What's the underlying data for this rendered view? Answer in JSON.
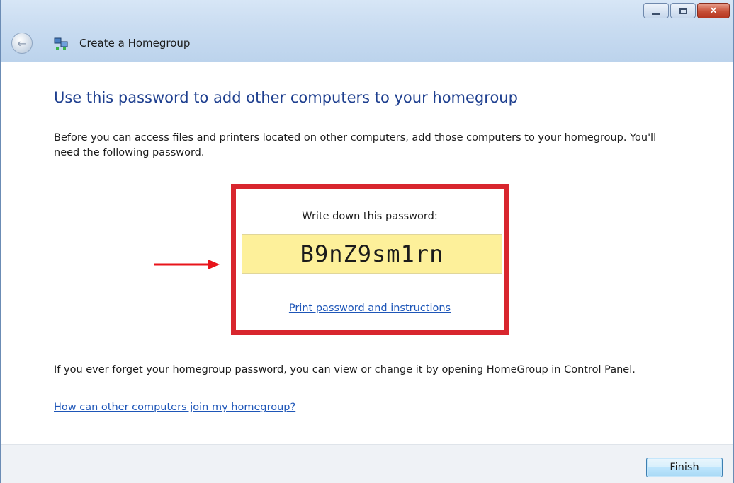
{
  "window": {
    "title": "Create a Homegroup",
    "controls": {
      "minimize": "minimize-icon",
      "maximize": "maximize-icon",
      "close": "×"
    }
  },
  "content": {
    "heading": "Use this password to add other computers to your homegroup",
    "intro": "Before you can access files and printers located on other computers, add those computers to your homegroup. You'll need the following password.",
    "password_label": "Write down this password:",
    "password": "B9nZ9sm1rn",
    "print_link": "Print password and instructions",
    "forget_text": "If you ever forget your homegroup password, you can view or change it by opening HomeGroup in Control Panel.",
    "join_link": "How can other computers join my homegroup?"
  },
  "footer": {
    "finish_label": "Finish"
  },
  "colors": {
    "heading": "#1e3f8f",
    "link": "#1e56b8",
    "highlight_border": "#d8262e",
    "password_bg": "#fdf09a",
    "arrow": "#e8141b"
  }
}
